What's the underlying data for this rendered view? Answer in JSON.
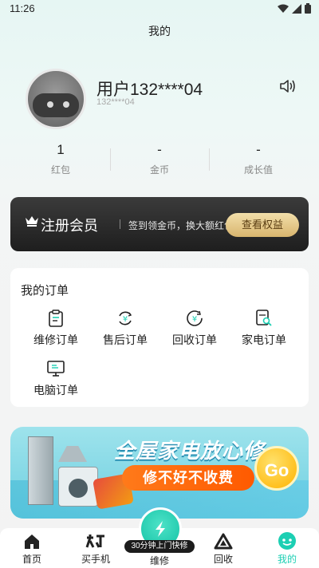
{
  "status_bar": {
    "time": "11:26",
    "icons": [
      "wifi-icon",
      "cellular-icon",
      "battery-icon"
    ]
  },
  "page": {
    "title": "我的"
  },
  "profile": {
    "name": "用户132****04",
    "phone": "132****04",
    "avatar_icon": "robot-avatar",
    "speaker_icon": "speaker-icon"
  },
  "stats": [
    {
      "value": "1",
      "label": "红包"
    },
    {
      "value": "-",
      "label": "金币"
    },
    {
      "value": "-",
      "label": "成长值"
    }
  ],
  "vip": {
    "title": "注册会员",
    "desc": "签到领金币，换大额红包",
    "button": "查看权益",
    "icon": "crown-icon"
  },
  "orders": {
    "title": "我的订单",
    "items": [
      {
        "label": "维修订单",
        "icon": "clipboard-icon"
      },
      {
        "label": "售后订单",
        "icon": "yuan-refresh-icon"
      },
      {
        "label": "回收订单",
        "icon": "yuan-cycle-icon"
      },
      {
        "label": "家电订单",
        "icon": "appliance-search-icon"
      },
      {
        "label": "电脑订单",
        "icon": "monitor-icon"
      }
    ]
  },
  "banner": {
    "headline": "全屋家电放心修",
    "tagline": "修不好不收费",
    "cta": "Go"
  },
  "tabbar": {
    "items": [
      {
        "label": "首页",
        "icon": "home-icon"
      },
      {
        "label": "买手机",
        "icon": "new-phone-icon"
      },
      {
        "label": "维修",
        "icon": "lightning-icon",
        "tag": "30分钟上门快修"
      },
      {
        "label": "回收",
        "icon": "recycle-triangle-icon"
      },
      {
        "label": "我的",
        "icon": "smiley-face-icon",
        "active": true
      }
    ]
  },
  "colors": {
    "accent": "#1ccfb3",
    "vip_gold": "#d8b56e",
    "banner_orange": "#ff5a00"
  }
}
